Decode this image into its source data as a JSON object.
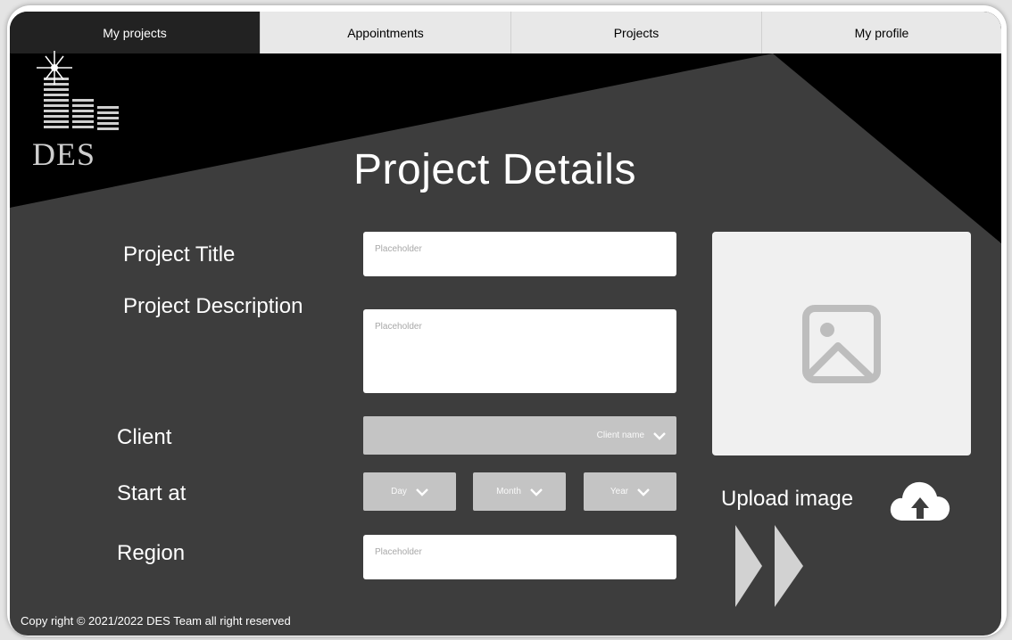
{
  "nav": {
    "tabs": [
      {
        "label": "My projects",
        "active": true
      },
      {
        "label": "Appointments",
        "active": false
      },
      {
        "label": "Projects",
        "active": false
      },
      {
        "label": "My profile",
        "active": false
      }
    ]
  },
  "logo": {
    "text": "DES"
  },
  "page_title": "Project Details",
  "form": {
    "project_title": {
      "label": "Project Title",
      "placeholder": "Placeholder"
    },
    "project_description": {
      "label": "Project Description",
      "placeholder": "Placeholder"
    },
    "client": {
      "label": "Client",
      "selected": "Client name"
    },
    "start_at": {
      "label": "Start at",
      "day": "Day",
      "month": "Month",
      "year": "Year"
    },
    "region": {
      "label": "Region",
      "placeholder": "Placeholder"
    }
  },
  "upload": {
    "label": "Upload image",
    "icon": "cloud-upload-icon"
  },
  "image_placeholder_icon": "image-icon",
  "next_icon": "fast-forward-icon",
  "footer": {
    "text": "Copy right © 2021/2022  DES Team all right reserved"
  },
  "colors": {
    "background": "#3d3d3d",
    "dark_shape": "#000000",
    "nav_active": "#222222",
    "nav_inactive": "#e8e8e8",
    "select_bg": "#c4c4c4"
  }
}
